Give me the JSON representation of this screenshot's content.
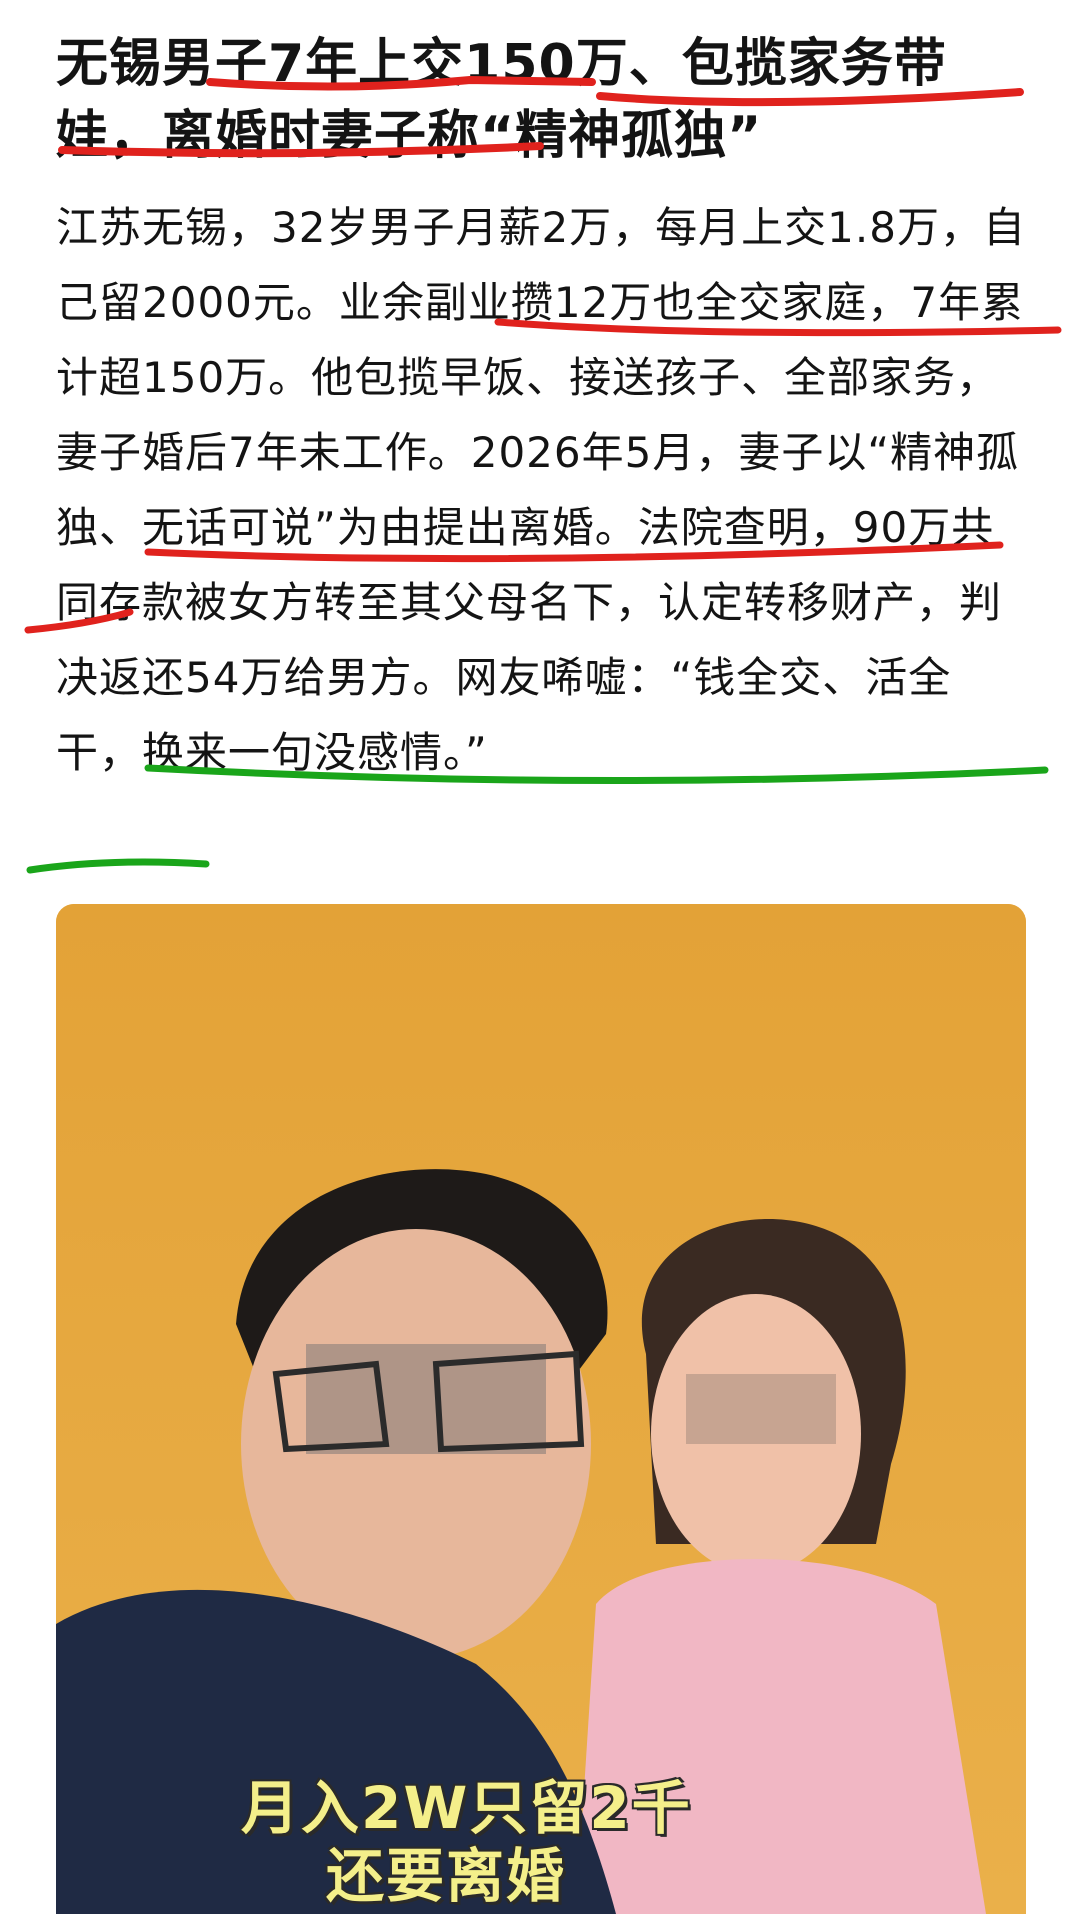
{
  "article": {
    "title": "无锡男子7年上交150万、包揽家务带娃，离婚时妻子称“精神孤独”",
    "body": "江苏无锡，32岁男子月薪2万，每月上交1.8万，自己留2000元。业余副业攒12万也全交家庭，7年累计超150万。他包揽早饭、接送孩子、全部家务，妻子婚后7年未工作。2026年5月，妻子以“精神孤独、无话可说”为由提出离婚。法院查明，90万共同存款被女方转至其父母名下，认定转移财产，判决返还54万给男方。网友唏嘘：“钱全交、活全干，换来一句没感情。”"
  },
  "photo": {
    "caption_line1": "月入2W只留2千",
    "caption_line2": "还要离婚",
    "background_color": "#e8a73a"
  },
  "colors": {
    "red_mark": "#e0221d",
    "green_mark": "#1aa51a",
    "caption_text": "#f4ef8a"
  }
}
